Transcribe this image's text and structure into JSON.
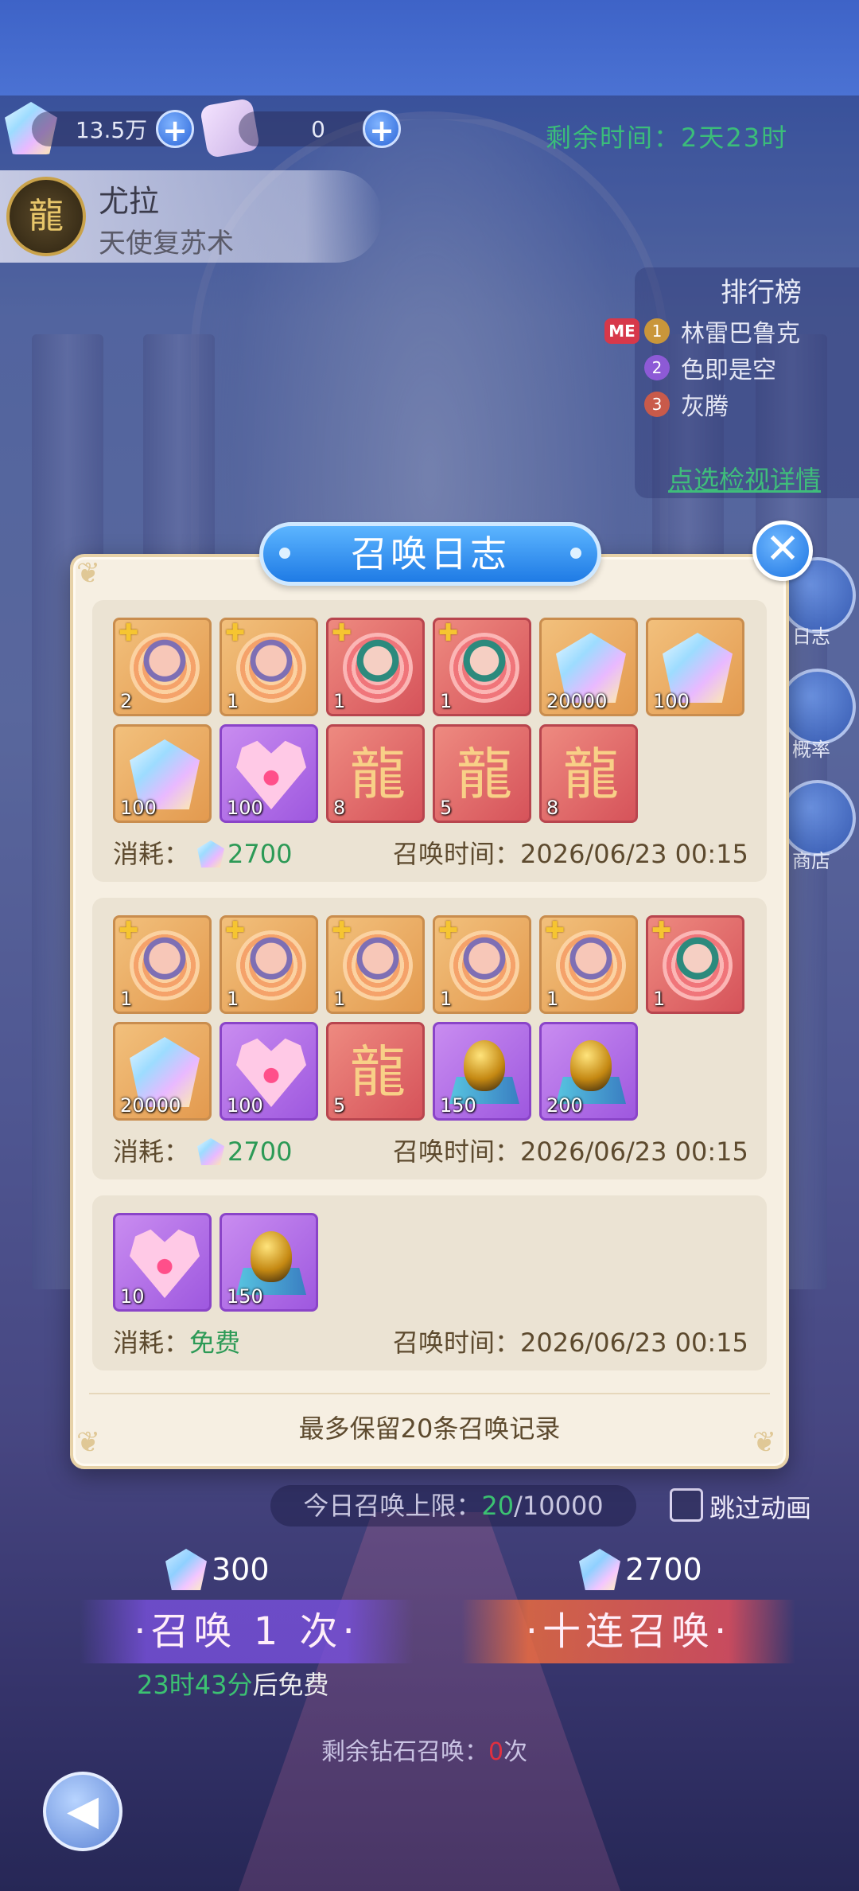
{
  "currency": {
    "gems": "13.5万",
    "tickets": "0"
  },
  "event": {
    "remaining_time": "剩余时间：2天23时"
  },
  "boss": {
    "name": "尤拉",
    "skill": "天使复苏术"
  },
  "ranking": {
    "title": "排行榜",
    "me_badge": "ME",
    "entries": [
      {
        "rank": "1",
        "name": "林雷巴鲁克"
      },
      {
        "rank": "2",
        "name": "色即是空"
      },
      {
        "rank": "3",
        "name": "灰腾"
      }
    ],
    "detail_link": "点选检视详情"
  },
  "side_buttons": [
    "日志",
    "概率",
    "商店"
  ],
  "modal": {
    "title": "召唤日志",
    "close": "✕",
    "footer": "最多保留20条召唤记录",
    "records": [
      {
        "cost_label": "消耗：",
        "cost": "2700",
        "time_label": "召唤时间：",
        "time": "2026/06/23 00:15",
        "items": [
          {
            "type": "fragment",
            "count": "2"
          },
          {
            "type": "fragment",
            "count": "1"
          },
          {
            "type": "fragment2",
            "count": "1"
          },
          {
            "type": "fragment2",
            "count": "1"
          },
          {
            "type": "gem",
            "count": "20000"
          },
          {
            "type": "gem",
            "count": "100"
          },
          {
            "type": "gem",
            "count": "100"
          },
          {
            "type": "heart",
            "count": "100"
          },
          {
            "type": "dragon",
            "count": "8"
          },
          {
            "type": "dragon",
            "count": "5"
          },
          {
            "type": "dragon",
            "count": "8"
          }
        ]
      },
      {
        "cost_label": "消耗：",
        "cost": "2700",
        "time_label": "召唤时间：",
        "time": "2026/06/23 00:15",
        "items": [
          {
            "type": "fragment",
            "count": "1"
          },
          {
            "type": "fragment",
            "count": "1"
          },
          {
            "type": "fragment",
            "count": "1"
          },
          {
            "type": "fragment",
            "count": "1"
          },
          {
            "type": "fragment",
            "count": "1"
          },
          {
            "type": "fragment2",
            "count": "1"
          },
          {
            "type": "gem",
            "count": "20000"
          },
          {
            "type": "heart",
            "count": "100"
          },
          {
            "type": "dragon",
            "count": "5"
          },
          {
            "type": "egg",
            "count": "150"
          },
          {
            "type": "egg",
            "count": "200"
          }
        ]
      },
      {
        "cost_label": "消耗：",
        "cost": "免费",
        "time_label": "召唤时间：",
        "time": "2026/06/23 00:15",
        "items": [
          {
            "type": "heart",
            "count": "10"
          },
          {
            "type": "egg",
            "count": "150"
          }
        ]
      }
    ]
  },
  "bottom": {
    "limit_label": "今日召唤上限：",
    "limit_used": "20",
    "limit_total": "/10000",
    "skip_label": "跳过动画",
    "single_cost": "300",
    "ten_cost": "2700",
    "summon_one": "·召唤 1 次·",
    "summon_ten": "·十连召唤·",
    "free_time": "23时43分",
    "free_suffix": "后免费",
    "diamond_left_label": "剩余钻石召唤：",
    "diamond_left_value": "0",
    "diamond_left_unit": "次"
  }
}
